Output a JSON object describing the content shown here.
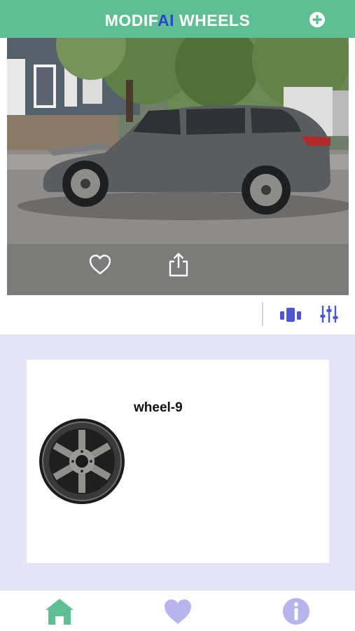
{
  "header": {
    "title_prefix": "MODIF",
    "title_highlight": "AI",
    "title_suffix": " WHEELS",
    "add_icon": "plus-circle-icon",
    "background_color": "#5fbf94",
    "highlight_color": "#2749c9"
  },
  "preview": {
    "like_icon": "heart-outline-icon",
    "share_icon": "share-icon"
  },
  "toolbar": {
    "compare_icon": "compare-icon",
    "filter_icon": "sliders-icon",
    "icon_color": "#4b56d6"
  },
  "wheels": [
    {
      "name": "wheel-9"
    }
  ],
  "tabbar": {
    "tabs": [
      {
        "id": "home",
        "icon": "home-icon",
        "active": true,
        "color": "#5fbf94"
      },
      {
        "id": "favorites",
        "icon": "heart-icon",
        "active": false,
        "color": "#b7b3ec"
      },
      {
        "id": "info",
        "icon": "info-icon",
        "active": false,
        "color": "#b7b3ec"
      }
    ]
  },
  "list_background": "#e4e3f7"
}
